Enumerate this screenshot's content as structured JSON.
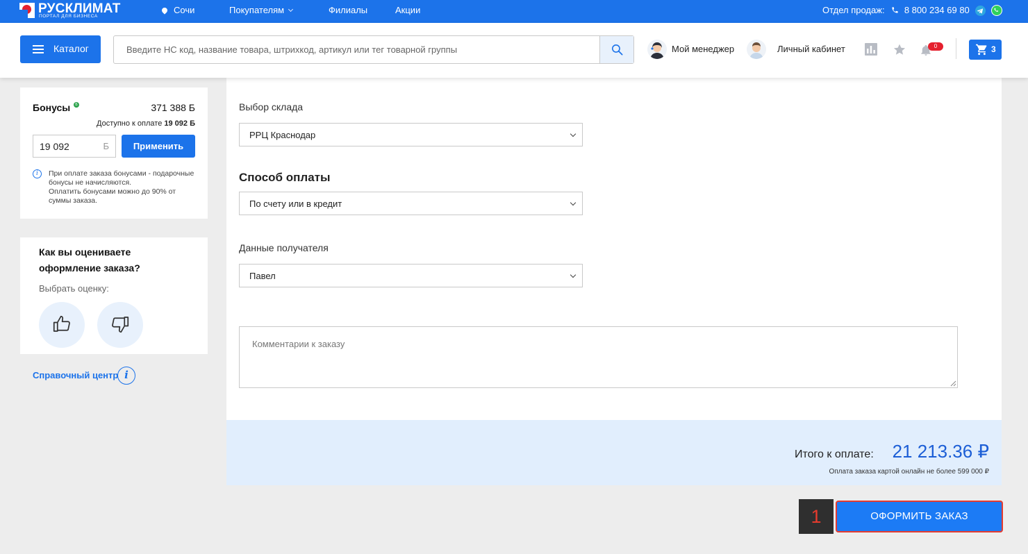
{
  "topbar": {
    "logo_name": "РУСКЛИМАТ",
    "logo_sub": "ПОРТАЛ ДЛЯ БИЗНЕСА",
    "city": "Сочи",
    "nav": [
      "Покупателям",
      "Филиалы",
      "Акции"
    ],
    "sales_label": "Отдел продаж:",
    "phone": "8 800 234 69 80",
    "icons": [
      "location-pin-icon",
      "chevron-down-icon",
      "phone-icon",
      "telegram-icon",
      "whatsapp-icon"
    ]
  },
  "header": {
    "catalog_label": "Каталог",
    "search_placeholder": "Введите НС код, название товара, штрихкод, артикул или тег товарной группы",
    "manager_label": "Мой менеджер",
    "account_label": "Личный кабинет",
    "notifications_count": "0",
    "cart_count": "3",
    "icons": [
      "burger-menu-icon",
      "search-icon",
      "compare-chart-icon",
      "star-icon",
      "bell-icon",
      "cart-icon"
    ]
  },
  "bonus": {
    "title": "Бонусы",
    "coin_symbol": "Б",
    "total": "371 388 Б",
    "available_prefix": "Доступно к оплате",
    "available_value": "19 092 Б",
    "input_value": "19 092",
    "input_unit": "Б",
    "apply_label": "Применить",
    "note_line1": "При оплате заказа бонусами - подарочные бонусы не начисляются.",
    "note_line2": "Оплатить бонусами можно до 90% от суммы заказа."
  },
  "rating": {
    "title": "Как вы оцениваете оформление заказа?",
    "subtitle": "Выбрать оценку:",
    "icons": [
      "thumbs-up-icon",
      "thumbs-down-icon"
    ]
  },
  "help": {
    "label": "Справочный центр",
    "icon": "info-icon"
  },
  "order_form": {
    "warehouse_label": "Выбор склада",
    "warehouse_value": "РРЦ Краснодар",
    "payment_heading": "Способ оплаты",
    "payment_value": "По счету или в кредит",
    "recipient_label": "Данные получателя",
    "recipient_value": "Павел",
    "comment_placeholder": "Комментарии к заказу"
  },
  "total": {
    "label": "Итого к оплате:",
    "value": "21 213.36 ₽",
    "note": "Оплата заказа картой онлайн не более 599 000 ₽"
  },
  "step_marker": "1",
  "submit_label": "ОФОРМИТЬ ЗАКАЗ",
  "colors": {
    "brand_blue": "#1c73ea",
    "highlight_red": "#e53b2f",
    "total_blue": "#1c5ed6",
    "panel_light_blue": "#e1eefd",
    "background": "#ededed"
  }
}
